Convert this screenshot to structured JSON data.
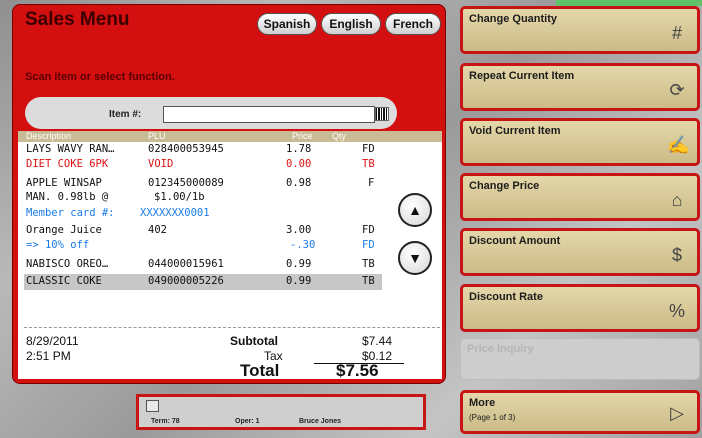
{
  "header": {
    "title": "Sales Menu",
    "languages": [
      "Spanish",
      "English",
      "French"
    ]
  },
  "instruction": "Scan item or select function.",
  "item_field": {
    "label": "Item #:",
    "value": ""
  },
  "receipt": {
    "columns": [
      "Description",
      "PLU",
      "Price",
      "Qty"
    ],
    "rows": [
      {
        "desc": "LAYS WAVY RAN…",
        "plu": "028400053945",
        "price": "1.78",
        "code": "FD",
        "style": "black"
      },
      {
        "desc": "DIET COKE 6PK",
        "plu": "VOID",
        "price": "0.00",
        "code": "TB",
        "style": "void"
      },
      {
        "desc": "APPLE WINSAP",
        "plu": "012345000089",
        "price": "0.98",
        "code": "F",
        "style": "black"
      },
      {
        "desc": "MAN. 0.98lb @",
        "plu": "$1.00/1b",
        "price": "",
        "code": "",
        "style": "black"
      },
      {
        "desc": "Member card #:",
        "plu": "XXXXXXX0001",
        "price": "",
        "code": "",
        "style": "blue"
      },
      {
        "desc": "Orange Juice",
        "plu": "402",
        "price": "3.00",
        "code": "FD",
        "style": "black"
      },
      {
        "desc": "=> 10% off",
        "plu": "",
        "price": "-.30",
        "code": "FD",
        "style": "blue"
      },
      {
        "desc": "NABISCO OREO…",
        "plu": "044000015961",
        "price": "0.99",
        "code": "TB",
        "style": "black"
      },
      {
        "desc": "CLASSIC COKE",
        "plu": "049000005226",
        "price": "0.99",
        "code": "TB",
        "style": "selected"
      }
    ],
    "date": "8/29/2011",
    "time": "2:51 PM",
    "subtotal_label": "Subtotal",
    "subtotal": "$7.44",
    "tax_label": "Tax",
    "tax": "$0.12",
    "total_label": "Total",
    "total": "$7.56"
  },
  "status_bar": {
    "term": "Term: 78",
    "oper": "Oper: 1",
    "user": "Bruce Jones"
  },
  "functions": [
    {
      "label": "Change Quantity",
      "icon": "hash-icon",
      "glyph": "#"
    },
    {
      "label": "Repeat Current Item",
      "icon": "repeat-icon",
      "glyph": "⟳"
    },
    {
      "label": "Void Current Item",
      "icon": "void-hand-icon",
      "glyph": "✍"
    },
    {
      "label": "Change Price",
      "icon": "price-tag-icon",
      "glyph": "⌂"
    },
    {
      "label": "Discount Amount",
      "icon": "dollar-icon",
      "glyph": "$"
    },
    {
      "label": "Discount Rate",
      "icon": "percent-icon",
      "glyph": "%"
    },
    {
      "label": "Price Inquiry",
      "disabled": true
    },
    {
      "label": "More",
      "sub": "(Page 1 of 3)",
      "icon": "next-arrow-icon",
      "glyph": "▷"
    }
  ],
  "colors": {
    "panel_red": "#d40f0f",
    "button_tan": "#d9cb9b",
    "button_border": "#c71414",
    "highlight_blue": "#1a7be6",
    "accent_green": "#5fc26a"
  }
}
